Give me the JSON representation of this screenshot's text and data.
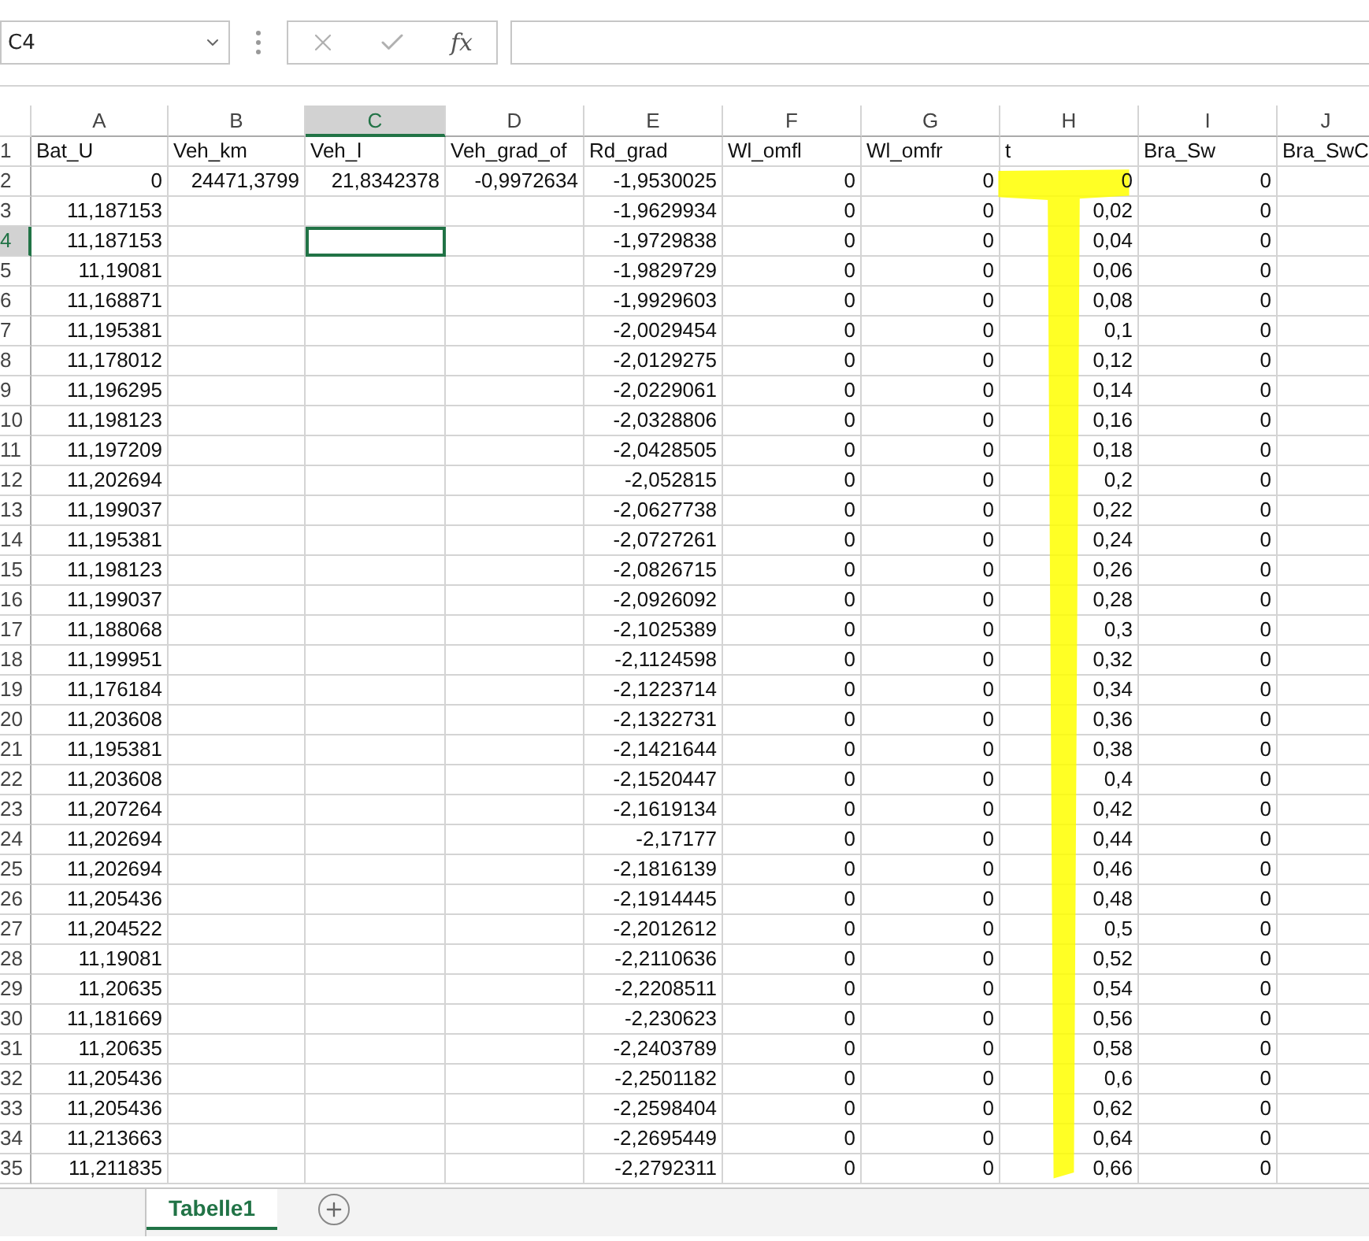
{
  "formula_bar": {
    "name_box": "C4",
    "function_button": "fx"
  },
  "columns": [
    {
      "letter": "A",
      "selected": false
    },
    {
      "letter": "B",
      "selected": false
    },
    {
      "letter": "C",
      "selected": true
    },
    {
      "letter": "D",
      "selected": false
    },
    {
      "letter": "E",
      "selected": false
    },
    {
      "letter": "F",
      "selected": false
    },
    {
      "letter": "G",
      "selected": false
    },
    {
      "letter": "H",
      "selected": false
    },
    {
      "letter": "I",
      "selected": false
    },
    {
      "letter": "J",
      "selected": false
    }
  ],
  "rows": [
    {
      "number": "1",
      "selected": false,
      "kind": "text",
      "cells": [
        "Bat_U",
        "Veh_km",
        "Veh_l",
        "Veh_grad_of",
        "Rd_grad",
        "Wl_omfl",
        "Wl_omfr",
        "t",
        "Bra_Sw",
        "Bra_SwC"
      ]
    },
    {
      "number": "2",
      "selected": false,
      "kind": "number",
      "cells": [
        "0",
        "24471,3799",
        "21,8342378",
        "-0,9972634",
        "-1,9530025",
        "0",
        "0",
        "0",
        "0",
        null
      ]
    },
    {
      "number": "3",
      "selected": false,
      "kind": "number",
      "cells": [
        "11,187153",
        null,
        null,
        null,
        "-1,9629934",
        "0",
        "0",
        "0,02",
        "0",
        null
      ]
    },
    {
      "number": "4",
      "selected": true,
      "kind": "number",
      "cells": [
        "11,187153",
        null,
        null,
        null,
        "-1,9729838",
        "0",
        "0",
        "0,04",
        "0",
        null
      ]
    },
    {
      "number": "5",
      "selected": false,
      "kind": "number",
      "cells": [
        "11,19081",
        null,
        null,
        null,
        "-1,9829729",
        "0",
        "0",
        "0,06",
        "0",
        null
      ]
    },
    {
      "number": "6",
      "selected": false,
      "kind": "number",
      "cells": [
        "11,168871",
        null,
        null,
        null,
        "-1,9929603",
        "0",
        "0",
        "0,08",
        "0",
        null
      ]
    },
    {
      "number": "7",
      "selected": false,
      "kind": "number",
      "cells": [
        "11,195381",
        null,
        null,
        null,
        "-2,0029454",
        "0",
        "0",
        "0,1",
        "0",
        null
      ]
    },
    {
      "number": "8",
      "selected": false,
      "kind": "number",
      "cells": [
        "11,178012",
        null,
        null,
        null,
        "-2,0129275",
        "0",
        "0",
        "0,12",
        "0",
        null
      ]
    },
    {
      "number": "9",
      "selected": false,
      "kind": "number",
      "cells": [
        "11,196295",
        null,
        null,
        null,
        "-2,0229061",
        "0",
        "0",
        "0,14",
        "0",
        null
      ]
    },
    {
      "number": "10",
      "selected": false,
      "kind": "number",
      "cells": [
        "11,198123",
        null,
        null,
        null,
        "-2,0328806",
        "0",
        "0",
        "0,16",
        "0",
        null
      ]
    },
    {
      "number": "11",
      "selected": false,
      "kind": "number",
      "cells": [
        "11,197209",
        null,
        null,
        null,
        "-2,0428505",
        "0",
        "0",
        "0,18",
        "0",
        null
      ]
    },
    {
      "number": "12",
      "selected": false,
      "kind": "number",
      "cells": [
        "11,202694",
        null,
        null,
        null,
        "-2,052815",
        "0",
        "0",
        "0,2",
        "0",
        null
      ]
    },
    {
      "number": "13",
      "selected": false,
      "kind": "number",
      "cells": [
        "11,199037",
        null,
        null,
        null,
        "-2,0627738",
        "0",
        "0",
        "0,22",
        "0",
        null
      ]
    },
    {
      "number": "14",
      "selected": false,
      "kind": "number",
      "cells": [
        "11,195381",
        null,
        null,
        null,
        "-2,0727261",
        "0",
        "0",
        "0,24",
        "0",
        null
      ]
    },
    {
      "number": "15",
      "selected": false,
      "kind": "number",
      "cells": [
        "11,198123",
        null,
        null,
        null,
        "-2,0826715",
        "0",
        "0",
        "0,26",
        "0",
        null
      ]
    },
    {
      "number": "16",
      "selected": false,
      "kind": "number",
      "cells": [
        "11,199037",
        null,
        null,
        null,
        "-2,0926092",
        "0",
        "0",
        "0,28",
        "0",
        null
      ]
    },
    {
      "number": "17",
      "selected": false,
      "kind": "number",
      "cells": [
        "11,188068",
        null,
        null,
        null,
        "-2,1025389",
        "0",
        "0",
        "0,3",
        "0",
        null
      ]
    },
    {
      "number": "18",
      "selected": false,
      "kind": "number",
      "cells": [
        "11,199951",
        null,
        null,
        null,
        "-2,1124598",
        "0",
        "0",
        "0,32",
        "0",
        null
      ]
    },
    {
      "number": "19",
      "selected": false,
      "kind": "number",
      "cells": [
        "11,176184",
        null,
        null,
        null,
        "-2,1223714",
        "0",
        "0",
        "0,34",
        "0",
        null
      ]
    },
    {
      "number": "20",
      "selected": false,
      "kind": "number",
      "cells": [
        "11,203608",
        null,
        null,
        null,
        "-2,1322731",
        "0",
        "0",
        "0,36",
        "0",
        null
      ]
    },
    {
      "number": "21",
      "selected": false,
      "kind": "number",
      "cells": [
        "11,195381",
        null,
        null,
        null,
        "-2,1421644",
        "0",
        "0",
        "0,38",
        "0",
        null
      ]
    },
    {
      "number": "22",
      "selected": false,
      "kind": "number",
      "cells": [
        "11,203608",
        null,
        null,
        null,
        "-2,1520447",
        "0",
        "0",
        "0,4",
        "0",
        null
      ]
    },
    {
      "number": "23",
      "selected": false,
      "kind": "number",
      "cells": [
        "11,207264",
        null,
        null,
        null,
        "-2,1619134",
        "0",
        "0",
        "0,42",
        "0",
        null
      ]
    },
    {
      "number": "24",
      "selected": false,
      "kind": "number",
      "cells": [
        "11,202694",
        null,
        null,
        null,
        "-2,17177",
        "0",
        "0",
        "0,44",
        "0",
        null
      ]
    },
    {
      "number": "25",
      "selected": false,
      "kind": "number",
      "cells": [
        "11,202694",
        null,
        null,
        null,
        "-2,1816139",
        "0",
        "0",
        "0,46",
        "0",
        null
      ]
    },
    {
      "number": "26",
      "selected": false,
      "kind": "number",
      "cells": [
        "11,205436",
        null,
        null,
        null,
        "-2,1914445",
        "0",
        "0",
        "0,48",
        "0",
        null
      ]
    },
    {
      "number": "27",
      "selected": false,
      "kind": "number",
      "cells": [
        "11,204522",
        null,
        null,
        null,
        "-2,2012612",
        "0",
        "0",
        "0,5",
        "0",
        null
      ]
    },
    {
      "number": "28",
      "selected": false,
      "kind": "number",
      "cells": [
        "11,19081",
        null,
        null,
        null,
        "-2,2110636",
        "0",
        "0",
        "0,52",
        "0",
        null
      ]
    },
    {
      "number": "29",
      "selected": false,
      "kind": "number",
      "cells": [
        "11,20635",
        null,
        null,
        null,
        "-2,2208511",
        "0",
        "0",
        "0,54",
        "0",
        null
      ]
    },
    {
      "number": "30",
      "selected": false,
      "kind": "number",
      "cells": [
        "11,181669",
        null,
        null,
        null,
        "-2,230623",
        "0",
        "0",
        "0,56",
        "0",
        null
      ]
    },
    {
      "number": "31",
      "selected": false,
      "kind": "number",
      "cells": [
        "11,20635",
        null,
        null,
        null,
        "-2,2403789",
        "0",
        "0",
        "0,58",
        "0",
        null
      ]
    },
    {
      "number": "32",
      "selected": false,
      "kind": "number",
      "cells": [
        "11,205436",
        null,
        null,
        null,
        "-2,2501182",
        "0",
        "0",
        "0,6",
        "0",
        null
      ]
    },
    {
      "number": "33",
      "selected": false,
      "kind": "number",
      "cells": [
        "11,205436",
        null,
        null,
        null,
        "-2,2598404",
        "0",
        "0",
        "0,62",
        "0",
        null
      ]
    },
    {
      "number": "34",
      "selected": false,
      "kind": "number",
      "cells": [
        "11,213663",
        null,
        null,
        null,
        "-2,2695449",
        "0",
        "0",
        "0,64",
        "0",
        null
      ]
    },
    {
      "number": "35",
      "selected": false,
      "kind": "number",
      "cells": [
        "11,211835",
        null,
        null,
        null,
        "-2,2792311",
        "0",
        "0",
        "0,66",
        "0",
        null
      ]
    }
  ],
  "sheet_tabs": [
    {
      "label": "Tabelle1",
      "selected": true
    }
  ]
}
